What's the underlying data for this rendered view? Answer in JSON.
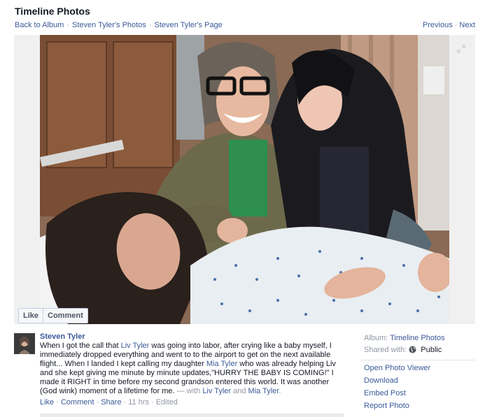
{
  "header": {
    "title": "Timeline Photos",
    "breadcrumbs": [
      "Back to Album",
      "Steven Tyler's Photos",
      "Steven Tyler's Page"
    ],
    "separator": "·",
    "previous": "Previous",
    "next": "Next"
  },
  "photo_actions": {
    "like": "Like",
    "comment": "Comment"
  },
  "post": {
    "author": "Steven Tyler",
    "text_1": "When I got the call that ",
    "link_liv": "Liv Tyler",
    "text_2": " was going into labor, after crying like a baby myself, I immediately dropped everything and went to to the airport to get on the next available flight... When I landed I kept calling my daughter ",
    "link_mia": "Mia Tyler",
    "text_3": " who was already helping Liv and she kept giving me minute by minute updates,\"HURRY THE BABY IS COMING!\" I made it RIGHT in time before my second grandson entered this world. It was another (God wink) moment of a lifetime for me. ",
    "with_prefix": "— with ",
    "tag_1": "Liv Tyler",
    "and_word": " and ",
    "tag_2": "Mia Tyler",
    "period": ".",
    "footer": {
      "like": "Like",
      "comment": "Comment",
      "share": "Share",
      "time": "11 hrs",
      "edited": "Edited"
    }
  },
  "sidebar": {
    "album_label": "Album:",
    "album_value": "Timeline Photos",
    "shared_label": "Shared with:",
    "shared_value": "Public",
    "actions": [
      "Open Photo Viewer",
      "Download",
      "Embed Post",
      "Report Photo"
    ]
  },
  "colors": {
    "link": "#3b5998",
    "muted": "#9197a3",
    "text": "#141823"
  },
  "icons": {
    "expand": "expand-icon",
    "globe": "globe-icon"
  }
}
